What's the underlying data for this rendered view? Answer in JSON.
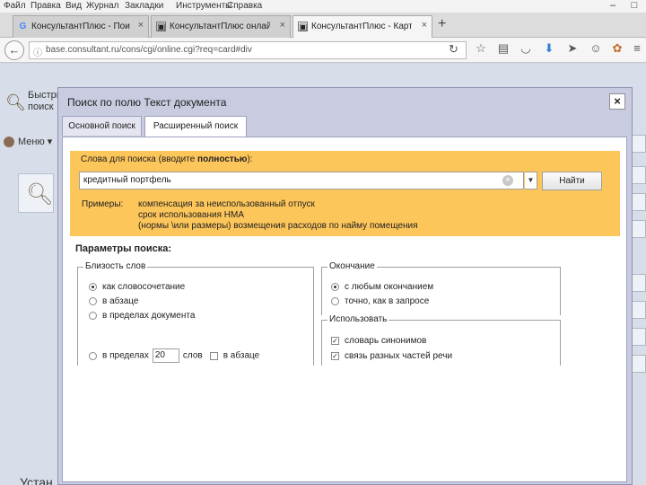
{
  "menubar": {
    "items": [
      "Файл",
      "Правка",
      "Вид",
      "Журнал",
      "Закладки",
      "Инструменты",
      "Справка"
    ]
  },
  "tabs": [
    {
      "title": "КонсультантПлюс - Поис...",
      "icon": "google-icon",
      "active": false
    },
    {
      "title": "КонсультантПлюс онлайн...",
      "icon": "consultant-icon",
      "active": false
    },
    {
      "title": "КонсультантПлюс - Карт...",
      "icon": "consultant-icon",
      "active": true
    }
  ],
  "address_bar": {
    "url": "base.consultant.ru/cons/cgi/online.cgi?req=card#div"
  },
  "page": {
    "quick_search": "Быстрый поиск",
    "menu": "Меню",
    "bottom_text": "Устан"
  },
  "dialog": {
    "title": "Поиск по полю Текст документа",
    "tabs": {
      "basic": "Основной поиск",
      "advanced": "Расширенный поиск"
    },
    "query_label_prefix": "Слова для поиска (вводите ",
    "query_label_bold": "полностью",
    "query_label_suffix": "):",
    "query_value": "кредитный портфель",
    "find_button": "Найти",
    "examples_label": "Примеры:",
    "examples": [
      "компенсация за неиспользованный отпуск",
      "срок использования НМА",
      "(нормы \\или размеры) возмещения расходов по найму помещения"
    ],
    "params_title": "Параметры поиска:",
    "closeness": {
      "title": "Близость слов",
      "options": [
        "как словосочетание",
        "в абзаце",
        "в пределах документа"
      ],
      "selected": 0,
      "within_prefix": "в пределах",
      "within_value": "20",
      "within_suffix": "слов",
      "within_paragraph": "в абзаце"
    },
    "ending": {
      "title": "Окончание",
      "options": [
        "с любым окончанием",
        "точно, как в запросе"
      ],
      "selected": 0
    },
    "use": {
      "title": "Использовать",
      "options": [
        "словарь синонимов",
        "связь разных частей речи"
      ],
      "checked": [
        true,
        true
      ]
    }
  }
}
